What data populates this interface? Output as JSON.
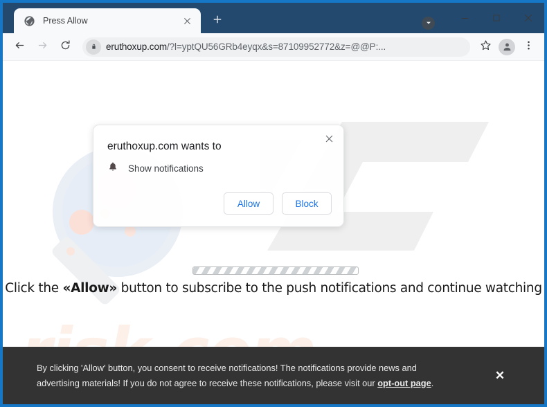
{
  "window": {
    "title_bar_color": "#24496e",
    "border_color": "#1577c6",
    "controls": {
      "dropdown_icon": "caret-down-circle-icon",
      "minimize_label": "—",
      "maximize_label": "□",
      "close_label": "✕"
    }
  },
  "tabs": [
    {
      "title": "Press Allow",
      "favicon": "globe-icon",
      "close_icon": "close-icon",
      "active": true
    }
  ],
  "new_tab": {
    "label": "+",
    "icon": "plus-icon"
  },
  "toolbar": {
    "back": {
      "icon": "arrow-left-icon",
      "enabled": true
    },
    "forward": {
      "icon": "arrow-right-icon",
      "enabled": false
    },
    "reload": {
      "icon": "reload-icon",
      "enabled": true
    },
    "omnibox": {
      "lock_icon": "lock-icon",
      "domain": "eruthoxup.com",
      "path": "/?l=yptQU56GRb4eyqx&s=87109952772&z=@@P:...",
      "full_url": "eruthoxup.com/?l=yptQU56GRb4eyqx&s=87109952772&z=@@P:..."
    },
    "bookmark": {
      "icon": "star-icon"
    },
    "profile": {
      "icon": "person-avatar-icon"
    },
    "menu": {
      "icon": "three-dot-menu-icon"
    }
  },
  "permission_dialog": {
    "title": "eruthoxup.com wants to",
    "permission_icon": "bell-icon",
    "permission_label": "Show notifications",
    "allow_label": "Allow",
    "block_label": "Block",
    "close_icon": "close-icon",
    "accent_color": "#1a73e8"
  },
  "page": {
    "headline_prefix": "Click the ",
    "headline_emphasis": "«Allow»",
    "headline_suffix": " button to subscribe to the push notifications and continue watching",
    "progress_bar": {
      "style": "striped",
      "name": "loading-progress-bar"
    },
    "watermarks": {
      "logo_text": "PC",
      "brand_text": "risk.com",
      "magnifier": "magnifying-glass-watermark"
    }
  },
  "consent_banner": {
    "line1": "By clicking 'Allow' button, you consent to receive notifications! The notifications provide news and",
    "line2_prefix": "advertising materials! If you do not agree to receive these notifications, please visit our ",
    "link_text": "opt-out page",
    "line2_suffix": ".",
    "close_label": "✕",
    "background_color": "#333333"
  }
}
